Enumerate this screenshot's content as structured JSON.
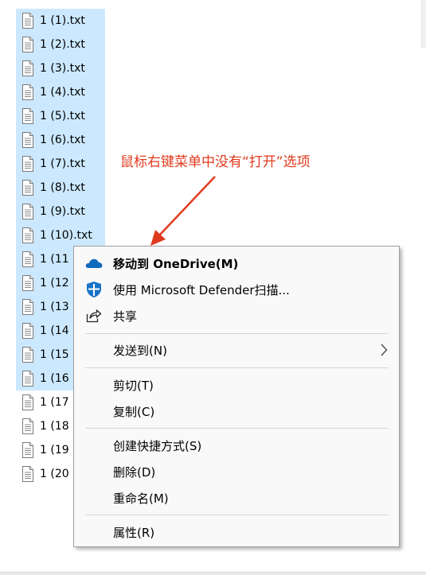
{
  "files": [
    {
      "name": "1 (1).txt",
      "selected": true
    },
    {
      "name": "1 (2).txt",
      "selected": true
    },
    {
      "name": "1 (3).txt",
      "selected": true
    },
    {
      "name": "1 (4).txt",
      "selected": true
    },
    {
      "name": "1 (5).txt",
      "selected": true
    },
    {
      "name": "1 (6).txt",
      "selected": true
    },
    {
      "name": "1 (7).txt",
      "selected": true
    },
    {
      "name": "1 (8).txt",
      "selected": true
    },
    {
      "name": "1 (9).txt",
      "selected": true
    },
    {
      "name": "1 (10).txt",
      "selected": true
    },
    {
      "name": "1 (11",
      "selected": true
    },
    {
      "name": "1 (12",
      "selected": true
    },
    {
      "name": "1 (13",
      "selected": true
    },
    {
      "name": "1 (14",
      "selected": true
    },
    {
      "name": "1 (15",
      "selected": true
    },
    {
      "name": "1 (16",
      "selected": true
    },
    {
      "name": "1 (17",
      "selected": false
    },
    {
      "name": "1 (18",
      "selected": false
    },
    {
      "name": "1 (19",
      "selected": false
    },
    {
      "name": "1 (20",
      "selected": false
    }
  ],
  "annotation": {
    "text": "鼠标右键菜单中没有“打开”选项",
    "color": "#e03a1e"
  },
  "context_menu": {
    "move_to_onedrive": "移动到 OneDrive(M)",
    "defender_scan": "使用 Microsoft Defender扫描...",
    "share": "共享",
    "send_to": "发送到(N)",
    "cut": "剪切(T)",
    "copy": "复制(C)",
    "create_shortcut": "创建快捷方式(S)",
    "delete": "删除(D)",
    "rename": "重命名(M)",
    "properties": "属性(R)"
  },
  "colors": {
    "selection": "#cce8ff",
    "onedrive_blue": "#0f6cbd",
    "defender_blue": "#1a73c8"
  },
  "icons": {
    "file": "text-file-icon",
    "onedrive": "onedrive-cloud-icon",
    "defender": "defender-shield-icon",
    "share": "share-icon",
    "submenu": "chevron-right-icon"
  }
}
